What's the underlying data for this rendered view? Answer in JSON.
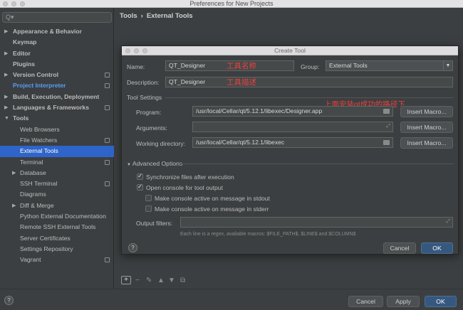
{
  "window": {
    "title": "Preferences for New Projects"
  },
  "sidebar": {
    "search_placeholder": "",
    "items": [
      {
        "label": "Appearance & Behavior",
        "arrow": "▶"
      },
      {
        "label": "Keymap"
      },
      {
        "label": "Editor",
        "arrow": "▶"
      },
      {
        "label": "Plugins"
      },
      {
        "label": "Version Control",
        "arrow": "▶"
      },
      {
        "label": "Project Interpreter"
      },
      {
        "label": "Build, Execution, Deployment",
        "arrow": "▶"
      },
      {
        "label": "Languages & Frameworks",
        "arrow": "▶"
      },
      {
        "label": "Tools",
        "arrow": "▼"
      },
      {
        "label": "Web Browsers"
      },
      {
        "label": "File Watchers"
      },
      {
        "label": "External Tools"
      },
      {
        "label": "Terminal"
      },
      {
        "label": "Database",
        "arrow": "▶"
      },
      {
        "label": "SSH Terminal"
      },
      {
        "label": "Diagrams"
      },
      {
        "label": "Diff & Merge",
        "arrow": "▶"
      },
      {
        "label": "Python External Documentation"
      },
      {
        "label": "Remote SSH External Tools"
      },
      {
        "label": "Server Certificates"
      },
      {
        "label": "Settings Repository"
      },
      {
        "label": "Vagrant"
      }
    ]
  },
  "breadcrumb": {
    "part1": "Tools",
    "sep": "›",
    "part2": "External Tools"
  },
  "dialog": {
    "title": "Create Tool",
    "name_label": "Name:",
    "name_value": "QT_Designer",
    "name_note": "工具名称",
    "group_label": "Group:",
    "group_value": "External Tools",
    "description_label": "Description:",
    "description_value": "QT_Designer",
    "description_note": "工具描述",
    "tool_settings": "Tool Settings",
    "path_note": "上面安装qt成功的路径下",
    "program_label": "Program:",
    "program_value": "/usr/local/Cellar/qt/5.12.1/libexec/Designer.app",
    "arguments_label": "Arguments:",
    "arguments_value": "",
    "workdir_label": "Working directory:",
    "workdir_value": "/usr/local/Cellar/qt/5.12.1/libexec",
    "insert_macro": "Insert Macro...",
    "advanced": "Advanced Options",
    "sync_files": "Synchronize files after execution",
    "open_console": "Open console for tool output",
    "console_stdout": "Make console active on message in stdout",
    "console_stderr": "Make console active on message in stderr",
    "output_filters_label": "Output filters:",
    "output_filters_value": "",
    "hint": "Each line is a regex, available macros: $FILE_PATH$, $LINE$ and $COLUMN$",
    "cancel": "Cancel",
    "ok": "OK"
  },
  "footer": {
    "cancel": "Cancel",
    "apply": "Apply",
    "ok": "OK"
  },
  "colors": {
    "accent": "#2f65ca",
    "primary_button": "#365880",
    "annotation": "#e8423f"
  }
}
